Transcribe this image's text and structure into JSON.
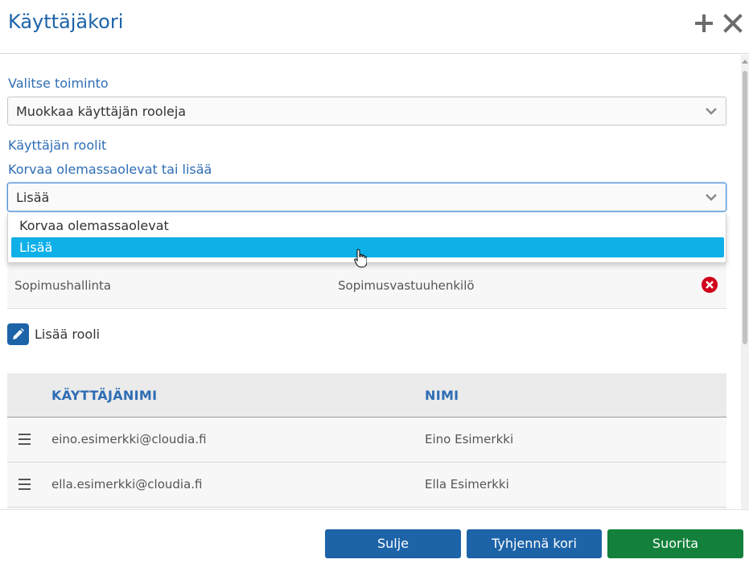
{
  "header": {
    "title": "Käyttäjäkori"
  },
  "form": {
    "action_label": "Valitse toiminto",
    "action_value": "Muokkaa käyttäjän rooleja",
    "roles_label": "Käyttäjän roolit",
    "mode_label": "Korvaa olemassaolevat tai lisää",
    "mode_value": "Lisää",
    "mode_options": [
      "Korvaa olemassaolevat",
      "Lisää"
    ]
  },
  "roles": [
    {
      "category": "Sopimushallinta",
      "name": "Sopimusvastuuhenkilö"
    }
  ],
  "add_role_label": "Lisää rooli",
  "table": {
    "columns": [
      "KÄYTTÄJÄNIMI",
      "NIMI"
    ],
    "rows": [
      {
        "username": "eino.esimerkki@cloudia.fi",
        "name": "Eino Esimerkki"
      },
      {
        "username": "ella.esimerkki@cloudia.fi",
        "name": "Ella Esimerkki"
      }
    ]
  },
  "footer": {
    "close_label": "Sulje",
    "clear_label": "Tyhjennä kori",
    "run_label": "Suorita"
  },
  "colors": {
    "primary": "#1d63a8",
    "success": "#13813c",
    "highlight": "#0fb0e8",
    "danger": "#d0021b"
  }
}
